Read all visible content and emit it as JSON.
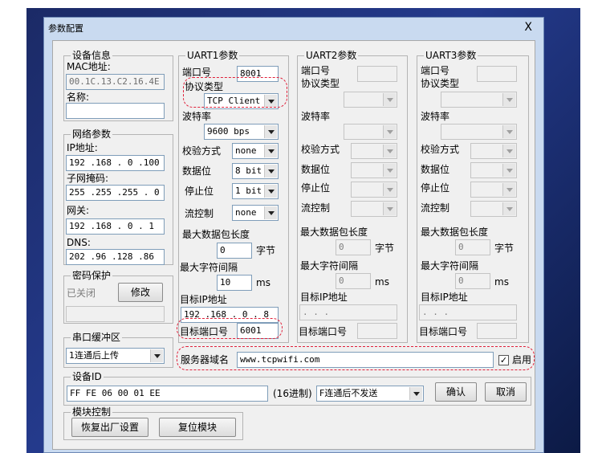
{
  "window": {
    "title": "参数配置",
    "close": "X"
  },
  "device_info": {
    "title": "设备信息",
    "mac_label": "MAC地址:",
    "mac_value": "00.1C.13.C2.16.4E",
    "name_label": "名称:",
    "name_value": ""
  },
  "network": {
    "title": "网络参数",
    "ip_label": "IP地址:",
    "ip_value": "192 .168 . 0  .100",
    "mask_label": "子网掩码:",
    "mask_value": "255 .255 .255 . 0",
    "gw_label": "网关:",
    "gw_value": "192 .168 . 0  . 1",
    "dns_label": "DNS:",
    "dns_value": "202 .96 .128 .86"
  },
  "password": {
    "title": "密码保护",
    "status": "已关闭",
    "modify": "修改",
    "value": ""
  },
  "serial_buffer": {
    "title": "串口缓冲区",
    "value": "1连通后上传"
  },
  "uart1": {
    "title": "UART1参数",
    "port_label": "端口号",
    "port_value": "8001",
    "proto_label": "协议类型",
    "proto_value": "TCP Client",
    "baud_label": "波特率",
    "baud_value": "9600 bps",
    "parity_label": "校验方式",
    "parity_value": "none",
    "databits_label": "数据位",
    "databits_value": "8 bit",
    "stopbits_label": "停止位",
    "stopbits_value": "1 bit",
    "flow_label": "流控制",
    "flow_value": "none",
    "maxpkt_label": "最大数据包长度",
    "maxpkt_value": "0",
    "maxpkt_unit": "字节",
    "maxgap_label": "最大字符间隔",
    "maxgap_value": "10",
    "maxgap_unit": "ms",
    "target_ip_label": "目标IP地址",
    "target_ip_value": "192 .168 . 0  . 8",
    "target_port_label": "目标端口号",
    "target_port_value": "6001"
  },
  "uart2": {
    "title": "UART2参数",
    "port_label": "端口号",
    "proto_label": "协议类型",
    "baud_label": "波特率",
    "parity_label": "校验方式",
    "databits_label": "数据位",
    "stopbits_label": "停止位",
    "flow_label": "流控制",
    "maxpkt_label": "最大数据包长度",
    "maxpkt_value": "0",
    "maxpkt_unit": "字节",
    "maxgap_label": "最大字符间隔",
    "maxgap_value": "0",
    "maxgap_unit": "ms",
    "target_ip_label": "目标IP地址",
    "target_ip_value": ".     .     .",
    "target_port_label": "目标端口号"
  },
  "uart3": {
    "title": "UART3参数",
    "port_label": "端口号",
    "proto_label": "协议类型",
    "baud_label": "波特率",
    "parity_label": "校验方式",
    "databits_label": "数据位",
    "stopbits_label": "停止位",
    "flow_label": "流控制",
    "maxpkt_label": "最大数据包长度",
    "maxpkt_value": "0",
    "maxpkt_unit": "字节",
    "maxgap_label": "最大字符间隔",
    "maxgap_value": "0",
    "maxgap_unit": "ms",
    "target_ip_label": "目标IP地址",
    "target_ip_value": ".     .     .",
    "target_port_label": "目标端口号"
  },
  "server": {
    "label": "服务器域名",
    "value": "www.tcpwifi.com",
    "enable_label": "启用",
    "enable_mark": "✓"
  },
  "device_id": {
    "title": "设备ID",
    "value": "FF FE 06 00 01 EE",
    "format": "(16进制)",
    "mode": "F连通后不发送",
    "ok": "确认",
    "cancel": "取消"
  },
  "module": {
    "title": "模块控制",
    "factory_reset": "恢复出厂设置",
    "reset": "复位模块"
  },
  "colors": {
    "highlight": "#e0203a",
    "background": "#1b2a66"
  }
}
